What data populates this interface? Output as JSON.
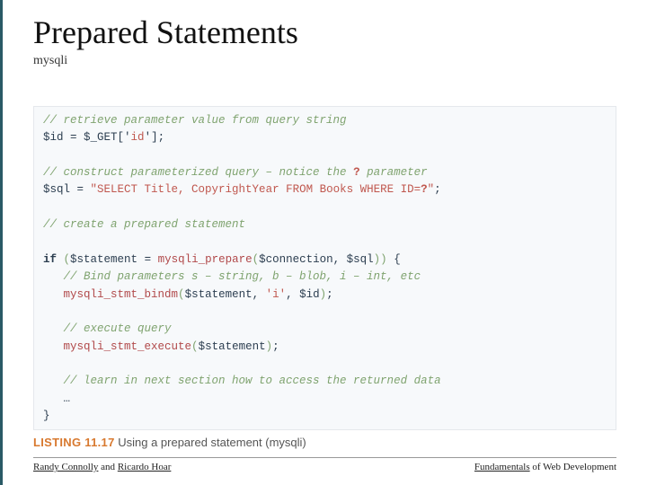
{
  "title": "Prepared Statements",
  "subtitle": "mysqli",
  "code": {
    "c1": "// retrieve parameter value from query string",
    "l1a": "$id",
    "l1b": " = ",
    "l1c": "$_GET['",
    "l1d": "id",
    "l1e": "'];",
    "c2a": "// construct parameterized query – notice the ",
    "c2b": "?",
    "c2c": " parameter",
    "l2a": "$sql",
    "l2b": " = ",
    "l2c": "\"SELECT Title, CopyrightYear FROM Books WHERE ID=",
    "l2d": "?",
    "l2e": "\"",
    "l2f": ";",
    "c3": "// create a prepared statement",
    "l3a": "if",
    "l3b": " ",
    "l3c": "(",
    "l3d": "$statement",
    "l3e": " = ",
    "l3f": "mysqli_prepare",
    "l3g": "(",
    "l3h": "$connection, $sql",
    "l3i": ")",
    "l3j": ")",
    "l3k": " {",
    "c4": "   // Bind parameters s – string, b – blob, i – int, etc",
    "l4a": "   ",
    "l4b": "mysqli_stmt_bindm",
    "l4c": "(",
    "l4d": "$statement, ",
    "l4e": "'i'",
    "l4f": ", $id",
    "l4g": ")",
    "l4h": ";",
    "c5": "   // execute query",
    "l5a": "   ",
    "l5b": "mysqli_stmt_execute",
    "l5c": "(",
    "l5d": "$statement",
    "l5e": ")",
    "l5f": ";",
    "c6": "   // learn in next section how to access the returned data",
    "l6": "   …",
    "l7": "}"
  },
  "listing": {
    "label": "LISTING 11.17",
    "text": " Using a prepared statement (mysqli)"
  },
  "footer": {
    "left_a": "Randy Connolly",
    "left_b": " and ",
    "left_c": "Ricardo Hoar",
    "right_a": "Fundamentals",
    "right_b": " of Web Development"
  }
}
